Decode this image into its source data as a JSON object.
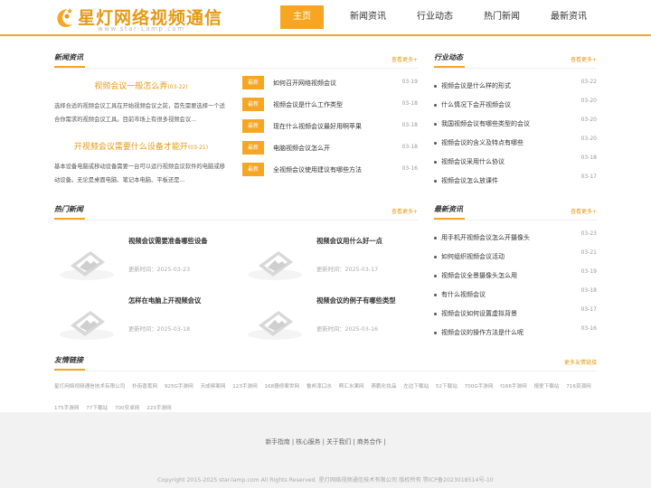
{
  "header": {
    "logo_title": "星灯网络视频通信",
    "logo_sub": "www.star-Lamp.com",
    "nav": [
      "主页",
      "新闻资讯",
      "行业动态",
      "热门新闻",
      "最新资讯"
    ]
  },
  "news": {
    "title": "新闻资讯",
    "more": "查看更多+",
    "featured": [
      {
        "title": "视频会议一般怎么弄",
        "date": "(03-22)",
        "text": "选择合适的视频会议工具在开始视频会议之前，首先需要选择一个适合你需求的视频会议工具。目前市场上有很多视频会议..."
      },
      {
        "title": "开视频会议需要什么设备才能开",
        "date": "(03-21)",
        "text": "基本设备电脑或移动设备需要一台可以运行视频会议软件的电脑或移动设备。无论是桌面电脑、笔记本电脑、平板还是..."
      }
    ],
    "badge": "最新",
    "list": [
      {
        "text": "如何召开网络视频会议",
        "date": "03-19"
      },
      {
        "text": "视频会议是什么工作类型",
        "date": "03-18"
      },
      {
        "text": "现在什么视频会议最好用啊苹果",
        "date": "03-18"
      },
      {
        "text": "电脑视频会议怎么开",
        "date": "03-18"
      },
      {
        "text": "全视频会议使用建议有哪些方法",
        "date": "03-16"
      }
    ]
  },
  "industry": {
    "title": "行业动态",
    "more": "查看更多+",
    "items": [
      {
        "text": "视频会议是什么样的形式",
        "date": "03-22"
      },
      {
        "text": "什么情况下会开视频会议",
        "date": "03-20"
      },
      {
        "text": "我国视频会议有哪些类型的会议",
        "date": "03-20"
      },
      {
        "text": "视频会议的含义及特点有哪些",
        "date": "03-20"
      },
      {
        "text": "视频会议采用什么协议",
        "date": "03-18"
      },
      {
        "text": "视频会议怎么放课件",
        "date": "03-17"
      }
    ]
  },
  "hot": {
    "title": "热门新闻",
    "more": "查看更多+",
    "time_label": "更新时间：",
    "cards": [
      {
        "title": "视频会议需要准备哪些设备",
        "time": "2025-03-23"
      },
      {
        "title": "视频会议用什么好一点",
        "time": "2025-03-17"
      },
      {
        "title": "怎样在电脑上开视频会议",
        "time": "2025-03-18"
      },
      {
        "title": "视频会议的例子有哪些类型",
        "time": "2025-03-16"
      }
    ]
  },
  "latest": {
    "title": "最新资讯",
    "more": "查看更多+",
    "items": [
      {
        "text": "用手机开视频会议怎么开摄像头",
        "date": "03-23"
      },
      {
        "text": "如何组织视频会议活动",
        "date": "03-21"
      },
      {
        "text": "视频会议全景摄像头怎么用",
        "date": "03-19"
      },
      {
        "text": "有什么视频会议",
        "date": "03-18"
      },
      {
        "text": "视频会议如何设置虚拟背景",
        "date": "03-17"
      },
      {
        "text": "视频会议的操作方法是什么呢",
        "date": "03-16"
      }
    ]
  },
  "friends": {
    "title": "友情链接",
    "more": "更多友情链接",
    "links": [
      "星灯网络视频通信技术有限公司",
      "扑街香蕉网",
      "925G手游网",
      "天成够案网",
      "123手游网",
      "168器修案世网",
      "鲁邦漆口水",
      "啊汇水果网",
      "燕鹏化妆品",
      "左边下载站",
      "52下载站",
      "700G手游网",
      "f166手游网",
      "报爱下载站",
      "716资源网",
      "175手游网",
      "77下载站",
      "700安卓网",
      "223手游网"
    ]
  },
  "footer": {
    "links": "新手指南 | 核心服务 | 关于我们 | 商务合作 |",
    "copyright": "Copyright 2015-2025 star-lamp.com All Rights Reserved. 星灯网络视频通信技术有限公司 版权所有 鄂ICP备2023018514号-10"
  }
}
